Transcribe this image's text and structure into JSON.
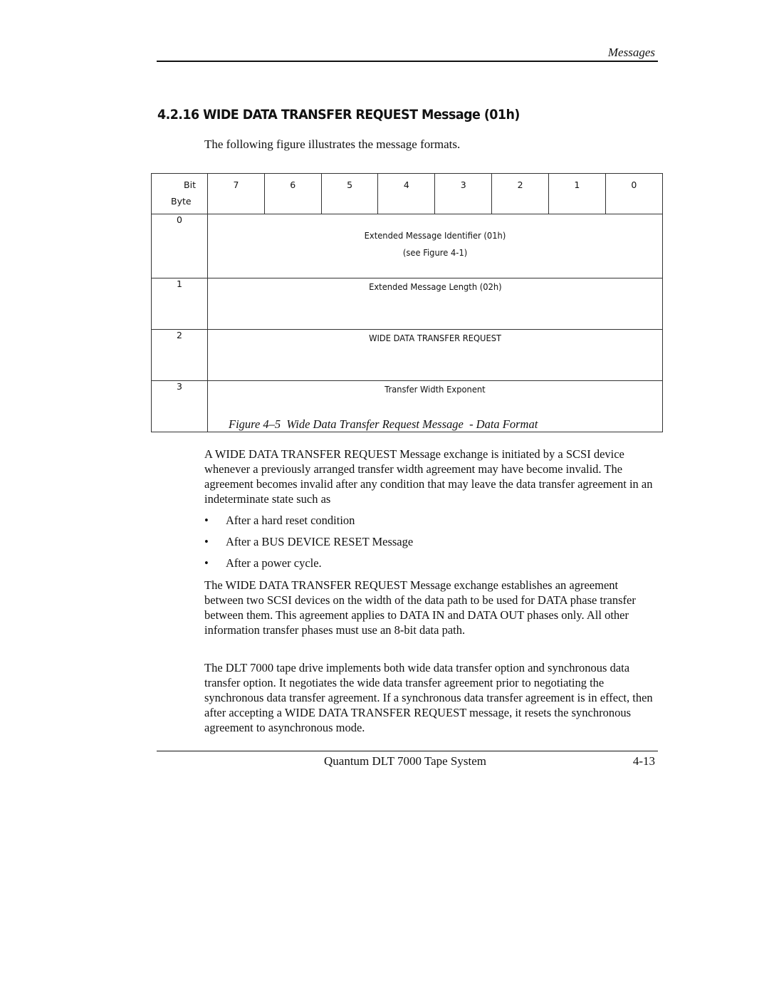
{
  "header": {
    "chapter": "Messages"
  },
  "section": {
    "title": "4.2.16  WIDE DATA TRANSFER REQUEST Message (01h)",
    "intro": "The following figure illustrates the message formats."
  },
  "table": {
    "corner_bit": "Bit",
    "corner_byte": "Byte",
    "bits": [
      "7",
      "6",
      "5",
      "4",
      "3",
      "2",
      "1",
      "0"
    ],
    "rows": [
      {
        "byte": "0",
        "line1": "Extended Message Identifier (01h)",
        "line2": "(see Figure 4-1)"
      },
      {
        "byte": "1",
        "line1": "Extended Message Length (02h)",
        "line2": ""
      },
      {
        "byte": "2",
        "line1": "WIDE DATA TRANSFER REQUEST",
        "line2": ""
      },
      {
        "byte": "3",
        "line1": "Transfer Width Exponent",
        "line2": ""
      }
    ]
  },
  "caption": "Figure 4–5  Wide Data Transfer Request Message  - Data Format",
  "paragraphs": [
    "A WIDE DATA TRANSFER REQUEST Message exchange is initiated by a SCSI device whenever a previously arranged transfer width agreement may have become invalid. The agreement becomes invalid after any condition that may leave the data transfer agreement in an indeterminate state such as",
    "The WIDE DATA TRANSFER REQUEST Message exchange establishes an agreement between two SCSI devices on the width of the data path to be used for DATA phase transfer between them. This agreement applies to DATA IN and DATA OUT phases only. All other information transfer phases must use an 8-bit data path.",
    "The DLT 7000 tape drive implements both wide data transfer option and synchronous data transfer option. It negotiates the wide data transfer agreement prior to negotiating the synchronous data transfer agreement. If a synchronous data transfer agreement is in effect, then after accepting a WIDE DATA TRANSFER REQUEST message, it resets the synchronous agreement to asynchronous mode."
  ],
  "bullet_glyph": "•",
  "bullets": [
    "After a hard reset condition",
    "After a BUS DEVICE RESET Message",
    "After a power cycle."
  ],
  "footer": {
    "title": "Quantum DLT 7000 Tape System",
    "page": "4-13"
  }
}
